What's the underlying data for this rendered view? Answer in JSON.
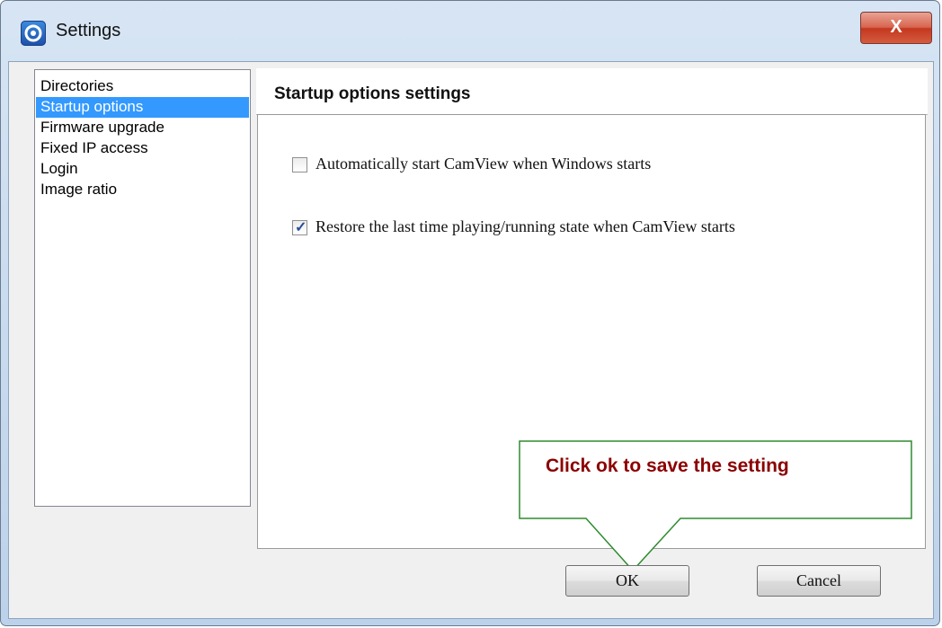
{
  "window": {
    "title": "Settings",
    "close_glyph": "X",
    "icon": "camview-app-icon"
  },
  "sidebar": {
    "items": [
      {
        "label": "Directories",
        "selected": false
      },
      {
        "label": "Startup options",
        "selected": true
      },
      {
        "label": "Firmware upgrade",
        "selected": false
      },
      {
        "label": "Fixed IP access",
        "selected": false
      },
      {
        "label": "Login",
        "selected": false
      },
      {
        "label": "Image ratio",
        "selected": false
      }
    ]
  },
  "panel": {
    "title": "Startup options settings",
    "options": [
      {
        "label": "Automatically start CamView when Windows starts",
        "checked": false
      },
      {
        "label": "Restore the last time playing/running state when CamView starts",
        "checked": true
      }
    ]
  },
  "callout": {
    "text": "Click ok to save the setting",
    "text_color": "#8b0000",
    "border_color": "#2e8b2e"
  },
  "buttons": {
    "ok": "OK",
    "cancel": "Cancel"
  },
  "colors": {
    "selection": "#3399ff",
    "close_button": "#c4371f"
  }
}
